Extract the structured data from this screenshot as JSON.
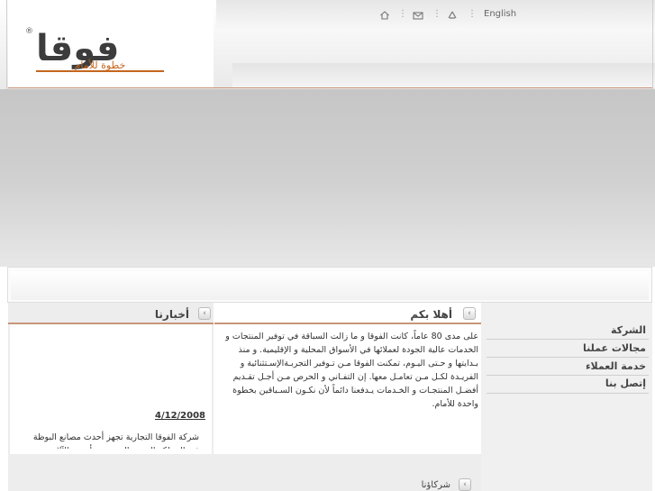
{
  "header": {
    "language_link": "English",
    "icons": [
      "home-icon",
      "mail-icon",
      "sitemap-icon"
    ]
  },
  "logo": {
    "wordmark": "فوقا",
    "tagline": "خطوة للأمام",
    "registered_mark": "®",
    "colors": {
      "wordmark": "#3c3c3c",
      "tagline": "#c4661f"
    }
  },
  "sidebar": {
    "items": [
      {
        "label": "الشركة"
      },
      {
        "label": "مجالات عملنا"
      },
      {
        "label": "خدمة العملاء"
      },
      {
        "label": "إتصل بنا"
      }
    ]
  },
  "welcome": {
    "title": "أهلا بكم",
    "body": "على مدى 80 عاماً، كانت الفوقا و ما زالت السباقة في توفير المنتجات و الخدمات عالية الجودة لعملائها في الأسواق المحلية و الإقليمية. و منذ بـدايتها و حـتى اليـوم، تمكنت الفوقا مـن تـوفير التجربـةالإسـتثنائية و الفريـدة لكـل مـن تعامـل معها.      إن التفـاني و الحرص مـن أجـل تقـديم أفضـل المنتجـات و الخـدمات يـدفعنا دائماً لأن نكـون السـباقين بخطوة واحدة للأمام."
  },
  "news": {
    "title": "أخبارنا",
    "date": "4/12/2008",
    "text": "شركة الفوقا التجارية تجهز أحدث مصانع البوظة في المملكة العربية السعودية بأحدث الآلات"
  },
  "partners": {
    "title": "شركاؤنا"
  },
  "colors": {
    "accent_rule": "#c8957a",
    "banner": "#cbcbcb",
    "sidebar_bg": "#f0f0f0"
  }
}
